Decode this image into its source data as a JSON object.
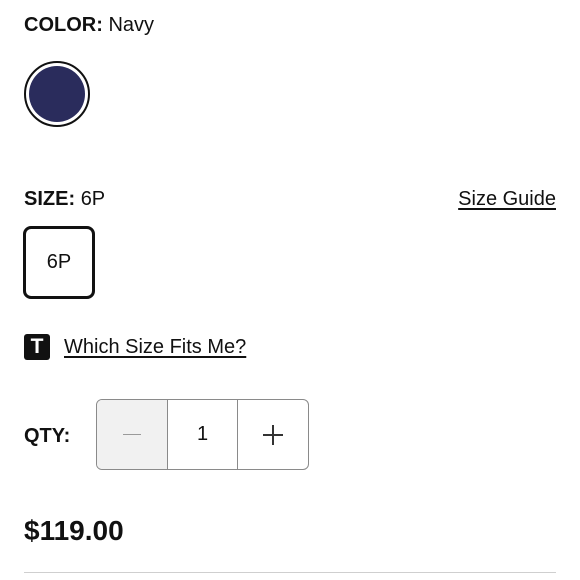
{
  "color": {
    "label": "COLOR:",
    "value": "Navy",
    "swatch_hex": "#2a2c5c"
  },
  "size": {
    "label": "SIZE:",
    "value": "6P",
    "guide_link": "Size Guide",
    "options": [
      {
        "label": "6P",
        "selected": true
      }
    ]
  },
  "fit": {
    "icon_letter": "T",
    "link": "Which Size Fits Me?"
  },
  "quantity": {
    "label": "QTY:",
    "value": "1"
  },
  "price": "$119.00"
}
